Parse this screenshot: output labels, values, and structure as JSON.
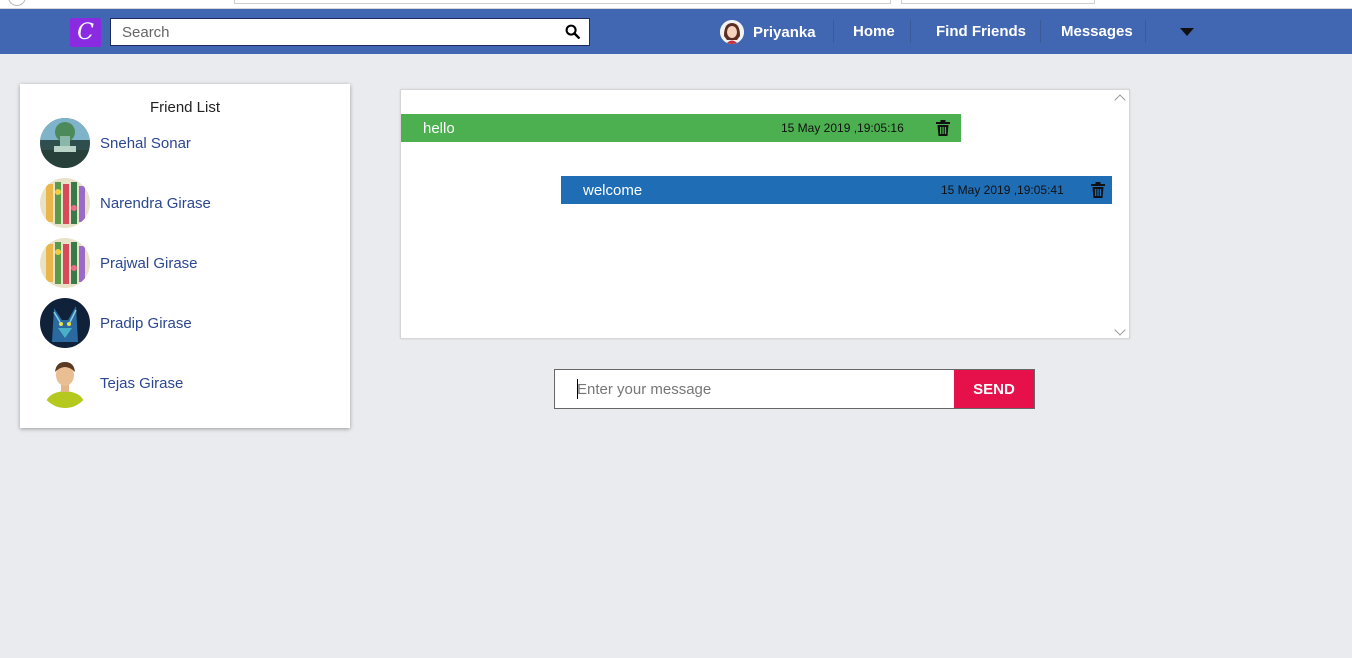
{
  "app": {
    "logo_letter": "C",
    "accent": "#4267b2",
    "logo_color": "#8a2be2"
  },
  "search": {
    "placeholder": "Search",
    "icon": "search-icon"
  },
  "nav": {
    "user": {
      "name": "Priyanka",
      "avatar": "user-avatar"
    },
    "items": [
      {
        "label": "Home"
      },
      {
        "label": "Find Friends"
      },
      {
        "label": "Messages"
      }
    ],
    "menu_icon": "caret-down-icon"
  },
  "friends": {
    "title": "Friend List",
    "items": [
      {
        "name": "Snehal Sonar",
        "avatar": "nature-photo-avatar"
      },
      {
        "name": "Narendra Girase",
        "avatar": "colorful-art-avatar"
      },
      {
        "name": "Prajwal Girase",
        "avatar": "colorful-art-avatar"
      },
      {
        "name": "Pradip Girase",
        "avatar": "wolf-art-avatar"
      },
      {
        "name": "Tejas Girase",
        "avatar": "default-person-avatar"
      }
    ]
  },
  "chat": {
    "messages": [
      {
        "text": "hello",
        "time": "15 May 2019 ,19:05:16",
        "direction": "sent",
        "color": "#4caf50"
      },
      {
        "text": "welcome",
        "time": "15 May 2019 ,19:05:41",
        "direction": "received",
        "color": "#1e6db5"
      }
    ]
  },
  "composer": {
    "placeholder": "Enter your message",
    "send_label": "SEND",
    "send_color": "#e6104a"
  }
}
